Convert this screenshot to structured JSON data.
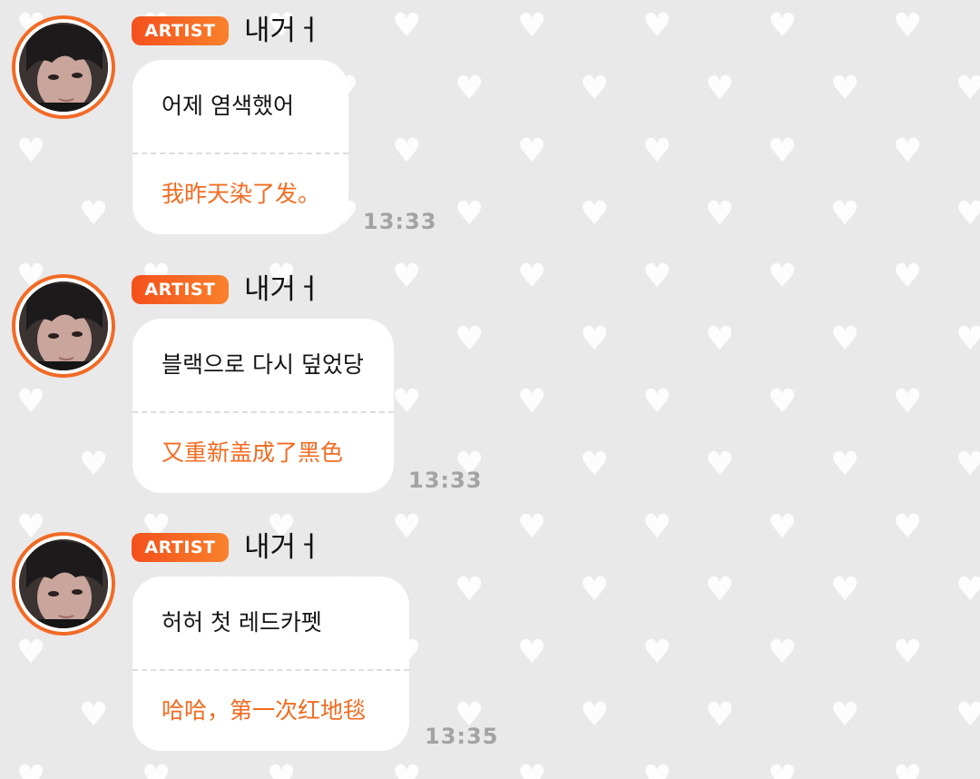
{
  "chat": {
    "messages": [
      {
        "badge": "ARTIST",
        "sender": "내거ㅓ",
        "korean": "어제 염색했어",
        "chinese": "我昨天染了发。",
        "time": "13:33"
      },
      {
        "badge": "ARTIST",
        "sender": "내거ㅓ",
        "korean": "블랙으로 다시 덮었당",
        "chinese": "又重新盖成了黑色",
        "time": "13:33"
      },
      {
        "badge": "ARTIST",
        "sender": "내거ㅓ",
        "korean": "허허 첫 레드카펫",
        "chinese": "哈哈，第一次红地毯",
        "time": "13:35"
      }
    ]
  },
  "theme": {
    "background": "#e9e9ea",
    "pattern": "white hearts",
    "badge_gradient": [
      "#f4501c",
      "#f9812c"
    ],
    "translation_color": "#f26b21",
    "timestamp_color": "#a3a3a3"
  }
}
